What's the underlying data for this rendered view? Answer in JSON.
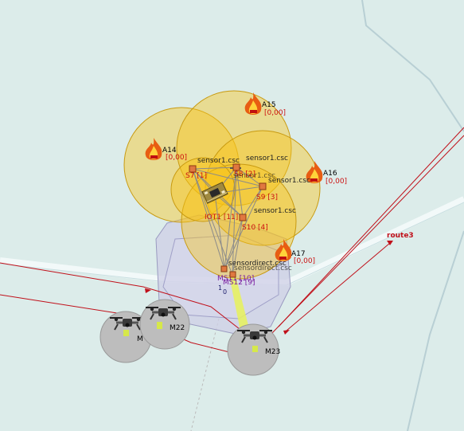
{
  "map": {
    "background_color": "#dcecea",
    "sensor_range_color": "#f8c418",
    "label_color_red": "#cc1111",
    "label_color_purple": "#7a1ea0",
    "route_color": "#c0101a"
  },
  "fires": [
    {
      "id": "A14",
      "label": "A14",
      "value": "[0,00]"
    },
    {
      "id": "A15",
      "label": "A15",
      "value": "[0,00]"
    },
    {
      "id": "A16",
      "label": "A16",
      "value": "[0,00]"
    },
    {
      "id": "A17",
      "label": "A17",
      "value": "[0,00]"
    }
  ],
  "sensors": [
    {
      "id": "S7",
      "label": "S7 [1]",
      "file": "sensor1.csc"
    },
    {
      "id": "S8",
      "label": "S8 [2]",
      "file": "sensor1.csc"
    },
    {
      "id": "S9",
      "label": "S9 [3]",
      "file": "sensor1.csc"
    },
    {
      "id": "S10",
      "label": "S10 [4]",
      "file": "sensor1.csc"
    }
  ],
  "iot": {
    "label": "IOT1 [11]"
  },
  "sinks": [
    {
      "id": "MS11",
      "label": "MS11 [10]",
      "file": "sensordirect.csc",
      "count": "1"
    },
    {
      "id": "MS12",
      "label": "MS12 [9]",
      "file": "sensordirect.csc",
      "count": "0"
    }
  ],
  "drones": [
    {
      "id": "M21",
      "label": "M"
    },
    {
      "id": "M22",
      "label": "M22"
    },
    {
      "id": "M23",
      "label": "M23"
    }
  ],
  "routes": [
    {
      "id": "route3",
      "label": "route3"
    }
  ]
}
